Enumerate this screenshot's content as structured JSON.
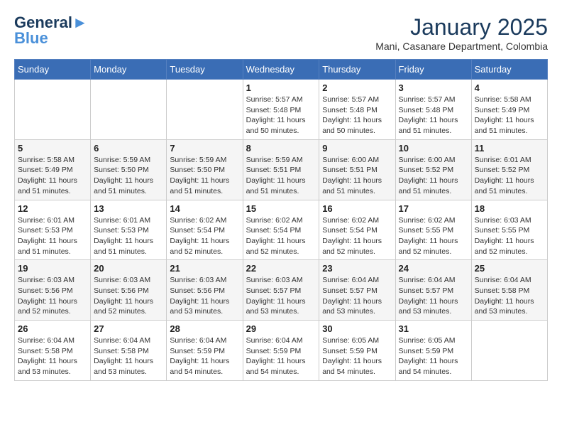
{
  "header": {
    "logo_line1": "General",
    "logo_line2": "Blue",
    "month": "January 2025",
    "location": "Mani, Casanare Department, Colombia"
  },
  "days_of_week": [
    "Sunday",
    "Monday",
    "Tuesday",
    "Wednesday",
    "Thursday",
    "Friday",
    "Saturday"
  ],
  "weeks": [
    [
      {
        "day": "",
        "info": ""
      },
      {
        "day": "",
        "info": ""
      },
      {
        "day": "",
        "info": ""
      },
      {
        "day": "1",
        "info": "Sunrise: 5:57 AM\nSunset: 5:48 PM\nDaylight: 11 hours and 50 minutes."
      },
      {
        "day": "2",
        "info": "Sunrise: 5:57 AM\nSunset: 5:48 PM\nDaylight: 11 hours and 50 minutes."
      },
      {
        "day": "3",
        "info": "Sunrise: 5:57 AM\nSunset: 5:48 PM\nDaylight: 11 hours and 51 minutes."
      },
      {
        "day": "4",
        "info": "Sunrise: 5:58 AM\nSunset: 5:49 PM\nDaylight: 11 hours and 51 minutes."
      }
    ],
    [
      {
        "day": "5",
        "info": "Sunrise: 5:58 AM\nSunset: 5:49 PM\nDaylight: 11 hours and 51 minutes."
      },
      {
        "day": "6",
        "info": "Sunrise: 5:59 AM\nSunset: 5:50 PM\nDaylight: 11 hours and 51 minutes."
      },
      {
        "day": "7",
        "info": "Sunrise: 5:59 AM\nSunset: 5:50 PM\nDaylight: 11 hours and 51 minutes."
      },
      {
        "day": "8",
        "info": "Sunrise: 5:59 AM\nSunset: 5:51 PM\nDaylight: 11 hours and 51 minutes."
      },
      {
        "day": "9",
        "info": "Sunrise: 6:00 AM\nSunset: 5:51 PM\nDaylight: 11 hours and 51 minutes."
      },
      {
        "day": "10",
        "info": "Sunrise: 6:00 AM\nSunset: 5:52 PM\nDaylight: 11 hours and 51 minutes."
      },
      {
        "day": "11",
        "info": "Sunrise: 6:01 AM\nSunset: 5:52 PM\nDaylight: 11 hours and 51 minutes."
      }
    ],
    [
      {
        "day": "12",
        "info": "Sunrise: 6:01 AM\nSunset: 5:53 PM\nDaylight: 11 hours and 51 minutes."
      },
      {
        "day": "13",
        "info": "Sunrise: 6:01 AM\nSunset: 5:53 PM\nDaylight: 11 hours and 51 minutes."
      },
      {
        "day": "14",
        "info": "Sunrise: 6:02 AM\nSunset: 5:54 PM\nDaylight: 11 hours and 52 minutes."
      },
      {
        "day": "15",
        "info": "Sunrise: 6:02 AM\nSunset: 5:54 PM\nDaylight: 11 hours and 52 minutes."
      },
      {
        "day": "16",
        "info": "Sunrise: 6:02 AM\nSunset: 5:54 PM\nDaylight: 11 hours and 52 minutes."
      },
      {
        "day": "17",
        "info": "Sunrise: 6:02 AM\nSunset: 5:55 PM\nDaylight: 11 hours and 52 minutes."
      },
      {
        "day": "18",
        "info": "Sunrise: 6:03 AM\nSunset: 5:55 PM\nDaylight: 11 hours and 52 minutes."
      }
    ],
    [
      {
        "day": "19",
        "info": "Sunrise: 6:03 AM\nSunset: 5:56 PM\nDaylight: 11 hours and 52 minutes."
      },
      {
        "day": "20",
        "info": "Sunrise: 6:03 AM\nSunset: 5:56 PM\nDaylight: 11 hours and 52 minutes."
      },
      {
        "day": "21",
        "info": "Sunrise: 6:03 AM\nSunset: 5:56 PM\nDaylight: 11 hours and 53 minutes."
      },
      {
        "day": "22",
        "info": "Sunrise: 6:03 AM\nSunset: 5:57 PM\nDaylight: 11 hours and 53 minutes."
      },
      {
        "day": "23",
        "info": "Sunrise: 6:04 AM\nSunset: 5:57 PM\nDaylight: 11 hours and 53 minutes."
      },
      {
        "day": "24",
        "info": "Sunrise: 6:04 AM\nSunset: 5:57 PM\nDaylight: 11 hours and 53 minutes."
      },
      {
        "day": "25",
        "info": "Sunrise: 6:04 AM\nSunset: 5:58 PM\nDaylight: 11 hours and 53 minutes."
      }
    ],
    [
      {
        "day": "26",
        "info": "Sunrise: 6:04 AM\nSunset: 5:58 PM\nDaylight: 11 hours and 53 minutes."
      },
      {
        "day": "27",
        "info": "Sunrise: 6:04 AM\nSunset: 5:58 PM\nDaylight: 11 hours and 53 minutes."
      },
      {
        "day": "28",
        "info": "Sunrise: 6:04 AM\nSunset: 5:59 PM\nDaylight: 11 hours and 54 minutes."
      },
      {
        "day": "29",
        "info": "Sunrise: 6:04 AM\nSunset: 5:59 PM\nDaylight: 11 hours and 54 minutes."
      },
      {
        "day": "30",
        "info": "Sunrise: 6:05 AM\nSunset: 5:59 PM\nDaylight: 11 hours and 54 minutes."
      },
      {
        "day": "31",
        "info": "Sunrise: 6:05 AM\nSunset: 5:59 PM\nDaylight: 11 hours and 54 minutes."
      },
      {
        "day": "",
        "info": ""
      }
    ]
  ]
}
